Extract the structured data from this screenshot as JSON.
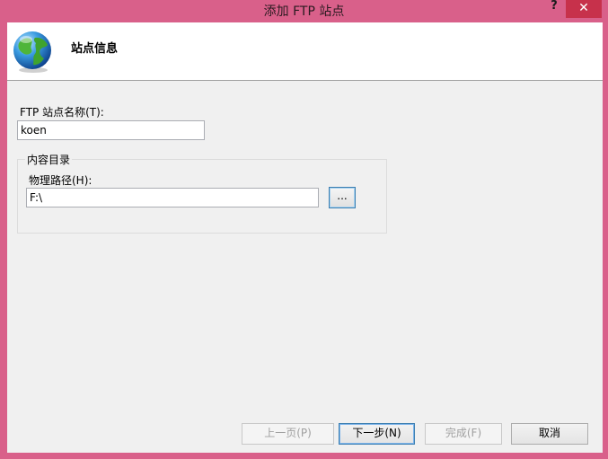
{
  "window": {
    "title": "添加 FTP 站点",
    "help_label": "?",
    "close_label": "✕"
  },
  "header": {
    "title": "站点信息",
    "icon": "globe-icon"
  },
  "form": {
    "site_name_label": "FTP 站点名称(T):",
    "site_name_value": "koen",
    "content_dir_label": "内容目录",
    "physical_path_label": "物理路径(H):",
    "physical_path_value": "F:\\",
    "browse_label": "..."
  },
  "footer": {
    "prev_label": "上一页(P)",
    "next_label": "下一步(N)",
    "finish_label": "完成(F)",
    "cancel_label": "取消"
  },
  "colors": {
    "frame": "#d9608a",
    "close": "#c7314b",
    "client": "#f0f0f0"
  }
}
